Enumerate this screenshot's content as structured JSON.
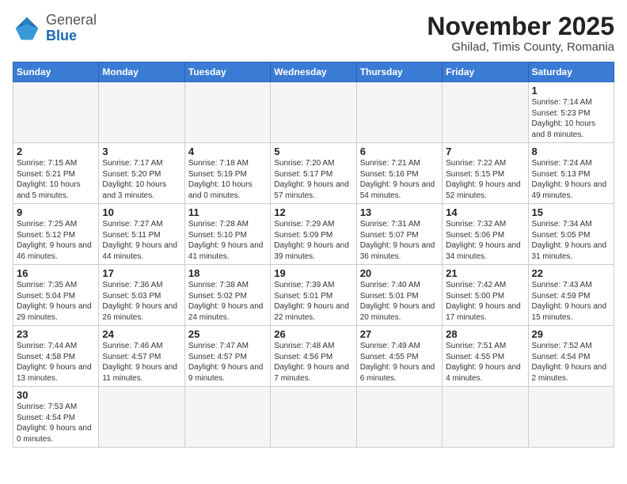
{
  "logo": {
    "general": "General",
    "blue": "Blue"
  },
  "title": "November 2025",
  "location": "Ghilad, Timis County, Romania",
  "days_of_week": [
    "Sunday",
    "Monday",
    "Tuesday",
    "Wednesday",
    "Thursday",
    "Friday",
    "Saturday"
  ],
  "weeks": [
    [
      {
        "day": "",
        "info": ""
      },
      {
        "day": "",
        "info": ""
      },
      {
        "day": "",
        "info": ""
      },
      {
        "day": "",
        "info": ""
      },
      {
        "day": "",
        "info": ""
      },
      {
        "day": "",
        "info": ""
      },
      {
        "day": "1",
        "info": "Sunrise: 7:14 AM\nSunset: 5:23 PM\nDaylight: 10 hours and 8 minutes."
      }
    ],
    [
      {
        "day": "2",
        "info": "Sunrise: 7:15 AM\nSunset: 5:21 PM\nDaylight: 10 hours and 5 minutes."
      },
      {
        "day": "3",
        "info": "Sunrise: 7:17 AM\nSunset: 5:20 PM\nDaylight: 10 hours and 3 minutes."
      },
      {
        "day": "4",
        "info": "Sunrise: 7:18 AM\nSunset: 5:19 PM\nDaylight: 10 hours and 0 minutes."
      },
      {
        "day": "5",
        "info": "Sunrise: 7:20 AM\nSunset: 5:17 PM\nDaylight: 9 hours and 57 minutes."
      },
      {
        "day": "6",
        "info": "Sunrise: 7:21 AM\nSunset: 5:16 PM\nDaylight: 9 hours and 54 minutes."
      },
      {
        "day": "7",
        "info": "Sunrise: 7:22 AM\nSunset: 5:15 PM\nDaylight: 9 hours and 52 minutes."
      },
      {
        "day": "8",
        "info": "Sunrise: 7:24 AM\nSunset: 5:13 PM\nDaylight: 9 hours and 49 minutes."
      }
    ],
    [
      {
        "day": "9",
        "info": "Sunrise: 7:25 AM\nSunset: 5:12 PM\nDaylight: 9 hours and 46 minutes."
      },
      {
        "day": "10",
        "info": "Sunrise: 7:27 AM\nSunset: 5:11 PM\nDaylight: 9 hours and 44 minutes."
      },
      {
        "day": "11",
        "info": "Sunrise: 7:28 AM\nSunset: 5:10 PM\nDaylight: 9 hours and 41 minutes."
      },
      {
        "day": "12",
        "info": "Sunrise: 7:29 AM\nSunset: 5:09 PM\nDaylight: 9 hours and 39 minutes."
      },
      {
        "day": "13",
        "info": "Sunrise: 7:31 AM\nSunset: 5:07 PM\nDaylight: 9 hours and 36 minutes."
      },
      {
        "day": "14",
        "info": "Sunrise: 7:32 AM\nSunset: 5:06 PM\nDaylight: 9 hours and 34 minutes."
      },
      {
        "day": "15",
        "info": "Sunrise: 7:34 AM\nSunset: 5:05 PM\nDaylight: 9 hours and 31 minutes."
      }
    ],
    [
      {
        "day": "16",
        "info": "Sunrise: 7:35 AM\nSunset: 5:04 PM\nDaylight: 9 hours and 29 minutes."
      },
      {
        "day": "17",
        "info": "Sunrise: 7:36 AM\nSunset: 5:03 PM\nDaylight: 9 hours and 26 minutes."
      },
      {
        "day": "18",
        "info": "Sunrise: 7:38 AM\nSunset: 5:02 PM\nDaylight: 9 hours and 24 minutes."
      },
      {
        "day": "19",
        "info": "Sunrise: 7:39 AM\nSunset: 5:01 PM\nDaylight: 9 hours and 22 minutes."
      },
      {
        "day": "20",
        "info": "Sunrise: 7:40 AM\nSunset: 5:01 PM\nDaylight: 9 hours and 20 minutes."
      },
      {
        "day": "21",
        "info": "Sunrise: 7:42 AM\nSunset: 5:00 PM\nDaylight: 9 hours and 17 minutes."
      },
      {
        "day": "22",
        "info": "Sunrise: 7:43 AM\nSunset: 4:59 PM\nDaylight: 9 hours and 15 minutes."
      }
    ],
    [
      {
        "day": "23",
        "info": "Sunrise: 7:44 AM\nSunset: 4:58 PM\nDaylight: 9 hours and 13 minutes."
      },
      {
        "day": "24",
        "info": "Sunrise: 7:46 AM\nSunset: 4:57 PM\nDaylight: 9 hours and 11 minutes."
      },
      {
        "day": "25",
        "info": "Sunrise: 7:47 AM\nSunset: 4:57 PM\nDaylight: 9 hours and 9 minutes."
      },
      {
        "day": "26",
        "info": "Sunrise: 7:48 AM\nSunset: 4:56 PM\nDaylight: 9 hours and 7 minutes."
      },
      {
        "day": "27",
        "info": "Sunrise: 7:49 AM\nSunset: 4:55 PM\nDaylight: 9 hours and 6 minutes."
      },
      {
        "day": "28",
        "info": "Sunrise: 7:51 AM\nSunset: 4:55 PM\nDaylight: 9 hours and 4 minutes."
      },
      {
        "day": "29",
        "info": "Sunrise: 7:52 AM\nSunset: 4:54 PM\nDaylight: 9 hours and 2 minutes."
      }
    ],
    [
      {
        "day": "30",
        "info": "Sunrise: 7:53 AM\nSunset: 4:54 PM\nDaylight: 9 hours and 0 minutes."
      },
      {
        "day": "",
        "info": ""
      },
      {
        "day": "",
        "info": ""
      },
      {
        "day": "",
        "info": ""
      },
      {
        "day": "",
        "info": ""
      },
      {
        "day": "",
        "info": ""
      },
      {
        "day": "",
        "info": ""
      }
    ]
  ]
}
